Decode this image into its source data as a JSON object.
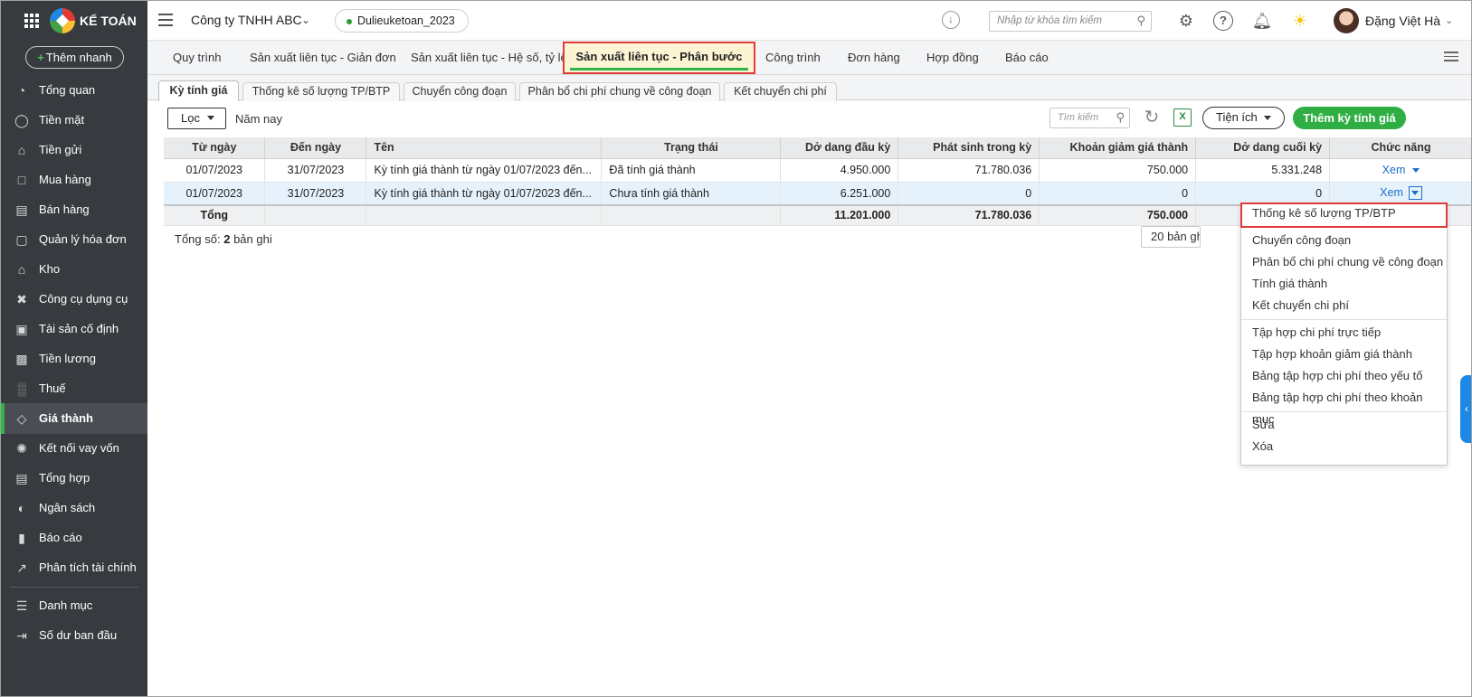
{
  "app": {
    "logo_text": "KẾ TOÁN"
  },
  "topbar": {
    "company": "Công ty TNHH ABC",
    "database": "Dulieuketoan_2023",
    "search_placeholder": "Nhập từ khóa tìm kiếm",
    "user_name": "Đặng Việt Hà"
  },
  "sidebar": {
    "quick_add": "Thêm nhanh",
    "items": [
      {
        "label": "Tổng quan",
        "icon": "chart-pie-icon"
      },
      {
        "label": "Tiền mặt",
        "icon": "money-bag-icon"
      },
      {
        "label": "Tiền gửi",
        "icon": "bank-icon"
      },
      {
        "label": "Mua hàng",
        "icon": "shopping-bag-icon"
      },
      {
        "label": "Bán hàng",
        "icon": "cart-icon"
      },
      {
        "label": "Quản lý hóa đơn",
        "icon": "invoice-icon"
      },
      {
        "label": "Kho",
        "icon": "warehouse-icon"
      },
      {
        "label": "Công cụ dụng cụ",
        "icon": "tools-icon"
      },
      {
        "label": "Tài sản cố định",
        "icon": "car-icon"
      },
      {
        "label": "Tiền lương",
        "icon": "payroll-icon"
      },
      {
        "label": "Thuế",
        "icon": "tax-icon"
      },
      {
        "label": "Giá thành",
        "icon": "price-tag-icon"
      },
      {
        "label": "Kết nối vay vốn",
        "icon": "loan-icon"
      },
      {
        "label": "Tổng hợp",
        "icon": "summary-icon"
      },
      {
        "label": "Ngân sách",
        "icon": "budget-icon"
      },
      {
        "label": "Báo cáo",
        "icon": "report-bars-icon"
      },
      {
        "label": "Phân tích tài chính",
        "icon": "trend-icon"
      },
      {
        "label": "Danh mục",
        "icon": "list-icon"
      },
      {
        "label": "Số dư ban đầu",
        "icon": "opening-balance-icon"
      }
    ],
    "active": "Giá thành"
  },
  "module_tabs": [
    "Quy trình",
    "Sản xuất liên tục - Giản đơn",
    "Sản xuất liên tục - Hệ số, tỷ lệ",
    "Sản xuất liên tục - Phân bước",
    "Công trình",
    "Đơn hàng",
    "Hợp đồng",
    "Báo cáo"
  ],
  "active_module_tab": "Sản xuất liên tục - Phân bước",
  "sub_tabs": [
    "Kỳ tính giá",
    "Thống kê số lượng TP/BTP",
    "Chuyển công đoạn",
    "Phân bổ chi phí chung về công đoạn",
    "Kết chuyển chi phí"
  ],
  "toolbar": {
    "filter": "Lọc",
    "period": "Năm nay",
    "search_placeholder": "Tìm kiếm",
    "utility": "Tiện ích",
    "add_button": "Thêm kỳ tính giá"
  },
  "table": {
    "columns": [
      "Từ ngày",
      "Đến ngày",
      "Tên",
      "Trạng thái",
      "Dở dang đầu kỳ",
      "Phát sinh trong kỳ",
      "Khoản giảm giá thành",
      "Dở dang cuối kỳ",
      "Chức năng"
    ],
    "rows": [
      [
        "01/07/2023",
        "31/07/2023",
        "Kỳ tính giá thành từ ngày 01/07/2023 đến...",
        "Đã tính giá thành",
        "4.950.000",
        "71.780.036",
        "750.000",
        "5.331.248",
        "Xem"
      ],
      [
        "01/07/2023",
        "31/07/2023",
        "Kỳ tính giá thành từ ngày 01/07/2023 đến...",
        "Chưa tính giá thành",
        "6.251.000",
        "0",
        "0",
        "0",
        "Xem"
      ]
    ],
    "total": {
      "label": "Tổng",
      "opening": "11.201.000",
      "incurred": "71.780.036",
      "reduction": "750.000"
    }
  },
  "footer": {
    "count_label": "Tổng số:",
    "count_value": "2",
    "count_suffix": "bản ghi",
    "page_size": "20 bản ghi"
  },
  "dropdown_menu": {
    "group1": [
      "Thống kê số lượng TP/BTP",
      "Chuyển công đoạn",
      "Phân bổ chi phí chung về công đoạn",
      "Tính giá thành",
      "Kết chuyển chi phí"
    ],
    "group2": [
      "Tập hợp chi phí trực tiếp",
      "Tập hợp khoản giảm giá thành",
      "Bảng tập hợp chi phí theo yếu tố",
      "Bảng tập hợp chi phí theo khoản mục"
    ],
    "group3": [
      "Sửa",
      "Xóa"
    ]
  },
  "colors": {
    "sidebar_bg": "#373a3f",
    "accent_green": "#2fae44",
    "highlight_red": "#e23b3b",
    "link_blue": "#1a6ecc"
  }
}
